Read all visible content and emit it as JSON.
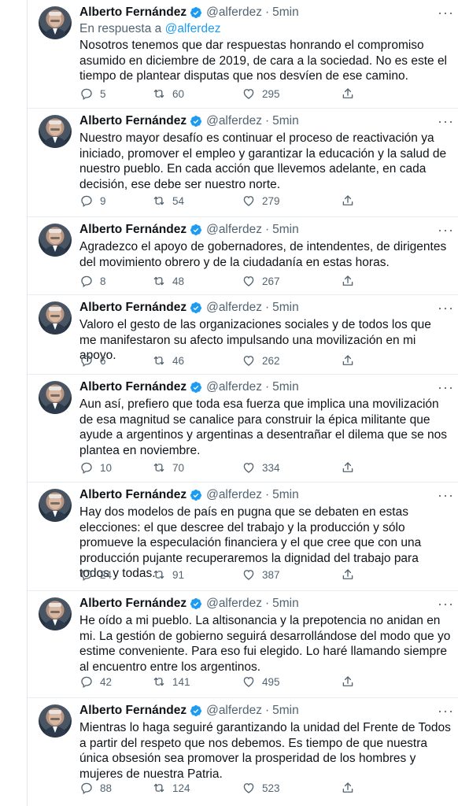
{
  "author": {
    "name": "Alberto Fernández",
    "handle": "@alferdez"
  },
  "colors": {
    "link": "#1d9bf0",
    "muted": "#536471",
    "verified": "#1d9bf0"
  },
  "tweets": [
    {
      "time": "5min",
      "reply_prefix": "En respuesta a",
      "reply_to": "@alferdez",
      "text": "Nosotros tenemos que dar respuestas honrando el compromiso asumido en diciembre de 2019, de cara a la sociedad. No es este el tiempo de plantear disputas que nos desvíen de ese camino.",
      "replies": "5",
      "retweets": "60",
      "likes": "295"
    },
    {
      "time": "5min",
      "text": "Nuestro mayor desafío es continuar el proceso de reactivación ya iniciado, promover el empleo y garantizar la educación y la salud de nuestro pueblo. En cada acción que llevemos adelante, en cada decisión, ese debe ser nuestro norte.",
      "replies": "9",
      "retweets": "54",
      "likes": "279"
    },
    {
      "time": "5min",
      "text": "Agradezco el apoyo de gobernadores, de intendentes, de dirigentes del movimiento obrero y de la ciudadanía en estas horas.",
      "replies": "8",
      "retweets": "48",
      "likes": "267"
    },
    {
      "time": "5min",
      "text": "Valoro el gesto de las organizaciones sociales y de todos los que me manifestaron su afecto impulsando una movilización en mi apoyo.",
      "replies": "6",
      "retweets": "46",
      "likes": "262"
    },
    {
      "time": "5min",
      "text": "Aun así, prefiero que toda esa fuerza que implica una movilización de esa magnitud se canalice para construir la épica militante que ayude a argentinos y argentinas a desentrañar el dilema que se nos plantea en noviembre.",
      "replies": "10",
      "retweets": "70",
      "likes": "334"
    },
    {
      "time": "5min",
      "text": "Hay dos modelos de país en pugna que se debaten en estas elecciones: el que descree del trabajo y la producción y sólo promueve la especulación financiera y el que cree que con una producción pujante recuperaremos la dignidad del trabajo para todos y todas.",
      "replies": "24",
      "retweets": "91",
      "likes": "387"
    },
    {
      "time": "5min",
      "text": "He oído a mi pueblo. La altisonancia y la prepotencia no anidan en mi. La gestión de gobierno seguirá desarrollándose del modo que yo estime conveniente. Para eso fui elegido. Lo haré llamando siempre al encuentro entre los argentinos.",
      "replies": "42",
      "retweets": "141",
      "likes": "495"
    },
    {
      "time": "5min",
      "text": "Mientras lo haga seguiré garantizando la unidad del Frente de Todos a partir del respeto que nos debemos. Es tiempo de que nuestra única obsesión sea promover la prosperidad de los hombres y mujeres de nuestra Patria.",
      "replies": "88",
      "retweets": "124",
      "likes": "523"
    }
  ]
}
